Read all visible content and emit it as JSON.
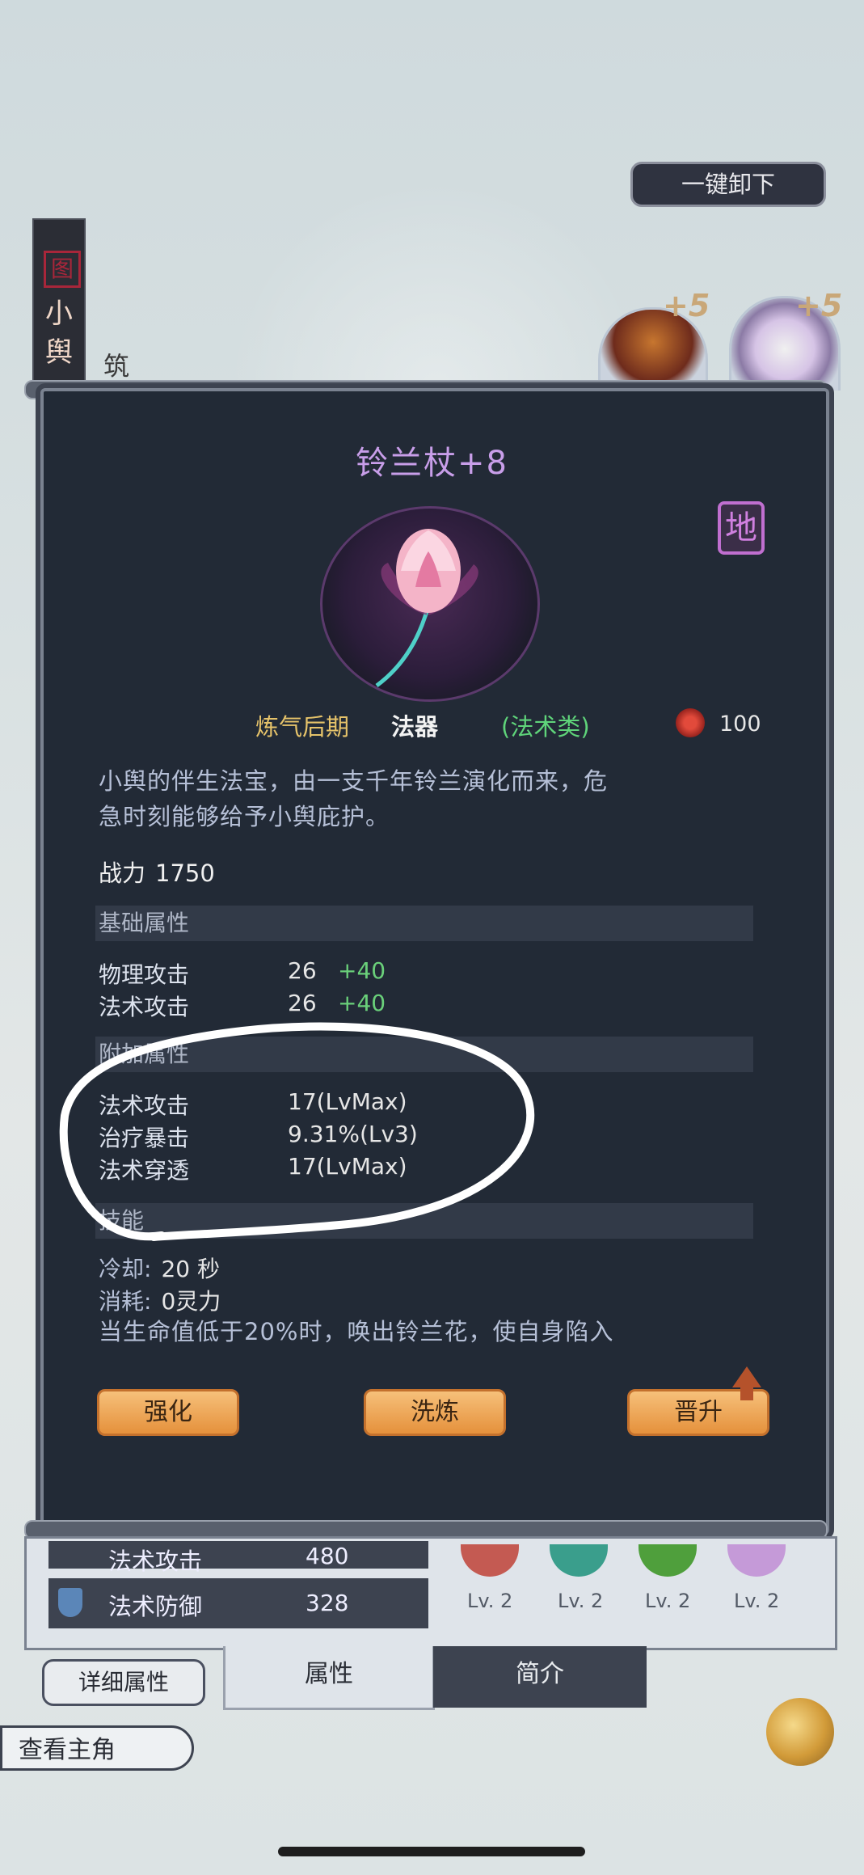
{
  "top_right_button": "一键卸下",
  "left_tab": {
    "seal": "图",
    "name_line1": "小",
    "name_line2": "舆",
    "sub": "筑"
  },
  "plus_badges": [
    "+5",
    "+5"
  ],
  "item": {
    "name": "铃兰杖+8",
    "grade_badge": "地",
    "realm": "炼气后期",
    "category": "法器",
    "type_tag": "(法术类)",
    "power_cost": "100",
    "description_line1": "小舆的伴生法宝，由一支千年铃兰演化而来，危",
    "description_line2": "急时刻能够给予小舆庇护。",
    "battle_power_label": "战力",
    "battle_power_value": "1750"
  },
  "sections": {
    "base_title": "基础属性",
    "extra_title": "附加属性",
    "skill_title": "技能"
  },
  "base_stats": [
    {
      "label": "物理攻击",
      "value": "26",
      "bonus": "+40"
    },
    {
      "label": "法术攻击",
      "value": "26",
      "bonus": "+40"
    }
  ],
  "extra_stats": [
    {
      "label": "法术攻击",
      "value": "17(LvMax)"
    },
    {
      "label": "治疗暴击",
      "value": "9.31%(Lv3)"
    },
    {
      "label": "法术穿透",
      "value": "17(LvMax)"
    }
  ],
  "skill": {
    "cooldown_label": "冷却:",
    "cooldown_value": "20 秒",
    "cost_label": "消耗:",
    "cost_value": "0灵力",
    "effect": "当生命值低于20%时，唤出铃兰花，使自身陷入"
  },
  "actions": {
    "enhance": "强化",
    "refine": "洗炼",
    "promote": "晋升"
  },
  "bottom_stats": [
    {
      "label": "法术攻击",
      "value": "480"
    },
    {
      "label": "法术防御",
      "value": "328"
    }
  ],
  "skill_levels": [
    "Lv. 2",
    "Lv. 2",
    "Lv. 2",
    "Lv. 2"
  ],
  "tabs": {
    "detail": "详细属性",
    "attributes": "属性",
    "intro": "简介"
  },
  "view_main": "查看主角",
  "colors": {
    "accent_title": "#c89ee9",
    "realm": "#e6c36a",
    "bonus": "#6ad07a",
    "button": "#e5913c"
  }
}
